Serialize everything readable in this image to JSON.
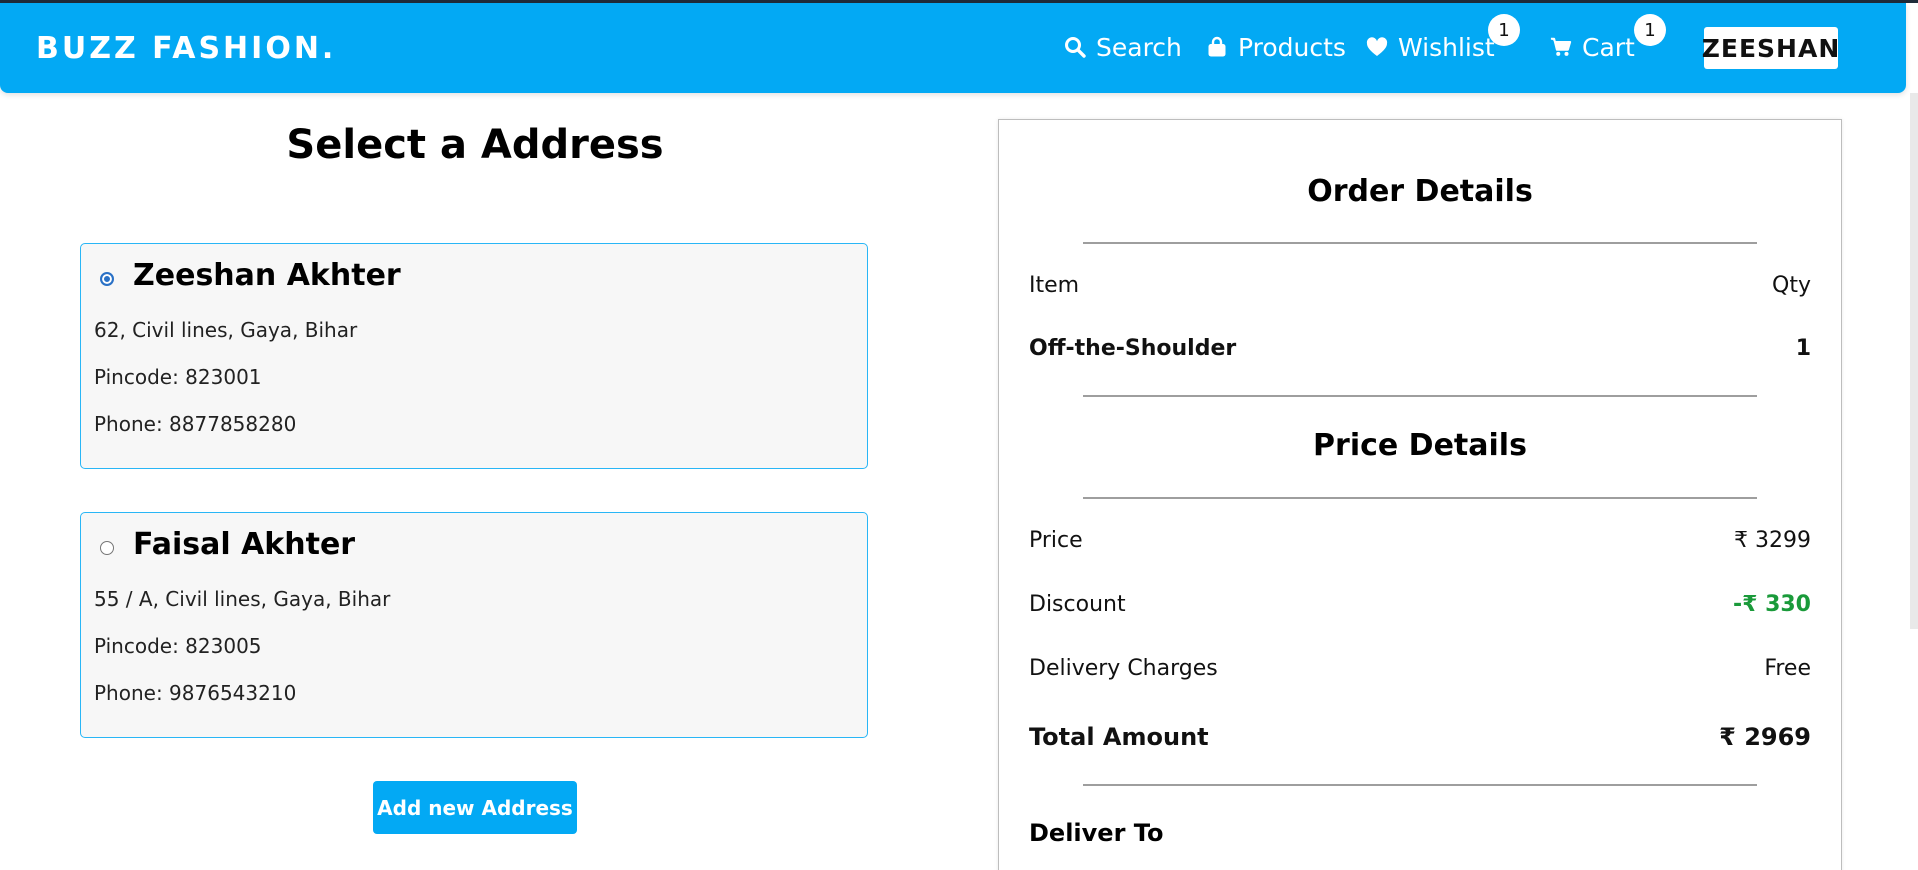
{
  "navbar": {
    "brand": "BUZZ FASHION.",
    "search_label": "Search",
    "products_label": "Products",
    "wishlist_label": "Wishlist",
    "wishlist_count": "1",
    "cart_label": "Cart",
    "cart_count": "1",
    "user_label": "ZEESHAN"
  },
  "address_section": {
    "title": "Select a Address",
    "addresses": [
      {
        "name": "Zeeshan Akhter",
        "address": "62, Civil lines, Gaya, Bihar",
        "pincode": "Pincode: 823001",
        "phone": "Phone: 8877858280",
        "selected": true
      },
      {
        "name": "Faisal Akhter",
        "address": "55 / A, Civil lines, Gaya, Bihar",
        "pincode": "Pincode: 823005",
        "phone": "Phone: 9876543210",
        "selected": false
      }
    ],
    "add_button_label": "Add new Address"
  },
  "order_details": {
    "title": "Order Details",
    "item_header": "Item",
    "qty_header": "Qty",
    "items": [
      {
        "name": "Off-the-Shoulder",
        "qty": "1"
      }
    ]
  },
  "price_details": {
    "title": "Price Details",
    "price_label": "Price",
    "price_value": "₹ 3299",
    "discount_label": "Discount",
    "discount_value": "-₹ 330",
    "delivery_label": "Delivery Charges",
    "delivery_value": "Free",
    "total_label": "Total Amount",
    "total_value": "₹ 2969",
    "deliver_to_label": "Deliver To"
  },
  "colors": {
    "brand_blue": "#03a9f4",
    "card_border": "#29b6f6",
    "discount_green": "#1a9a3a"
  },
  "icons": {
    "search": "search-icon",
    "products": "shopping-bag-icon",
    "wishlist": "heart-icon",
    "cart": "cart-icon"
  }
}
